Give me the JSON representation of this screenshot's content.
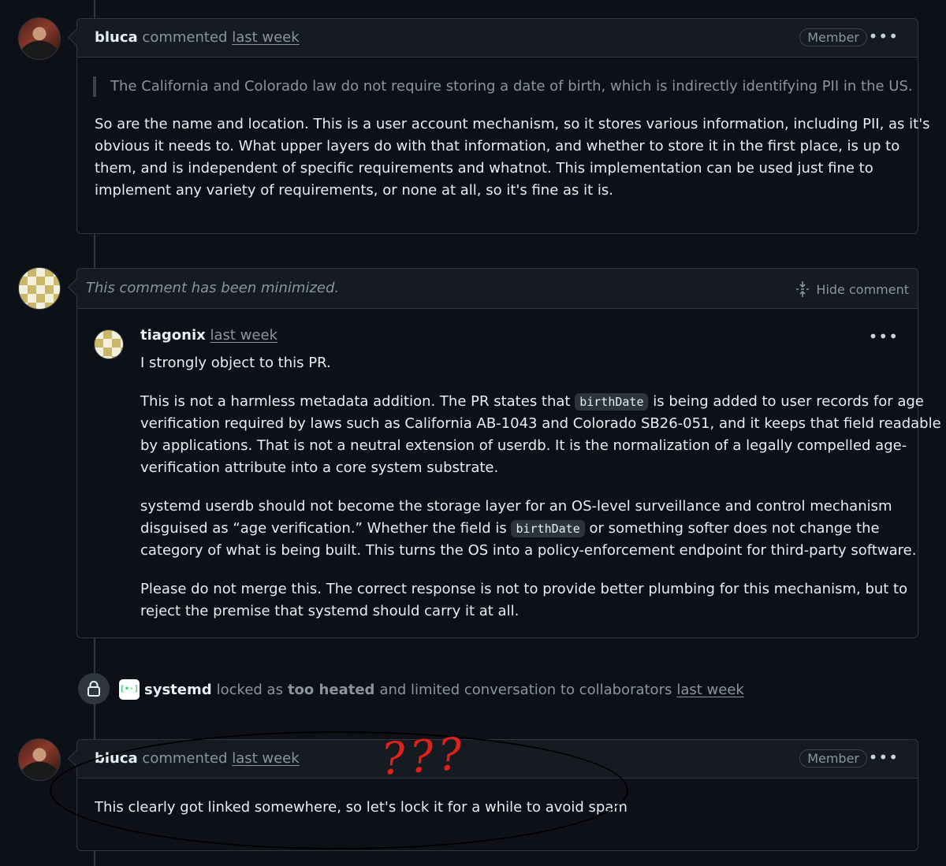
{
  "comment1": {
    "author": "bluca",
    "action": "commented",
    "time": "last week",
    "badge": "Member",
    "more": "•••",
    "quote": "The California and Colorado law do not require storing a date of birth, which is indirectly identifying PII in the US.",
    "body": [
      "So are the name and location. This is a user account mechanism, so it stores various information, including PII, as it's",
      "obvious it needs to. What upper layers do with that information, and whether to store it in the first place, is up to",
      "them, and is independent of specific requirements and whatnot. This implementation can be used just fine to",
      "implement any variety of requirements, or none at all, so it's fine as it is."
    ]
  },
  "comment2": {
    "minimized_text": "This comment has been minimized.",
    "hide_label": "Hide comment",
    "author": "tiagonix",
    "time": "last week",
    "more": "•••",
    "p1": "I strongly object to this PR.",
    "p2_a": "This is not a harmless metadata addition. The PR states that",
    "code1": "birthDate",
    "p2_b": "is being added to user records for age",
    "p2_c": "verification required by laws such as California AB-1043 and Colorado SB26-051, and it keeps that field readable",
    "p2_d": "by applications. That is not a neutral extension of userdb. It is the normalization of a legally compelled age-",
    "p2_e": "verification attribute into a core system substrate.",
    "p3_a": "systemd userdb should not become the storage layer for an OS-level surveillance and control mechanism",
    "p3_b": "disguised as “age verification.” Whether the field is",
    "code2": "birthDate",
    "p3_c": "or something softer does not change the",
    "p3_d": "category of what is being built. This turns the OS into a policy-enforcement endpoint for third-party software.",
    "p4_a": "Please do not merge this. The correct response is not to provide better plumbing for this mechanism, but to",
    "p4_b": "reject the premise that systemd should carry it at all."
  },
  "lock_event": {
    "actor": "systemd",
    "text1": "locked as",
    "reason": "too heated",
    "text2": "and limited conversation to collaborators",
    "time": "last week"
  },
  "comment3": {
    "author": "bluca",
    "action": "commented",
    "time": "last week",
    "badge": "Member",
    "more": "•••",
    "body": "This clearly got linked somewhere, so let's lock it for a while to avoid spam"
  },
  "annotation": {
    "question_marks": "???"
  },
  "colors": {
    "background": "#0d1117",
    "header": "#161b22",
    "border": "#30363d",
    "muted": "#8b949e",
    "annotation_red": "#e0201a"
  }
}
